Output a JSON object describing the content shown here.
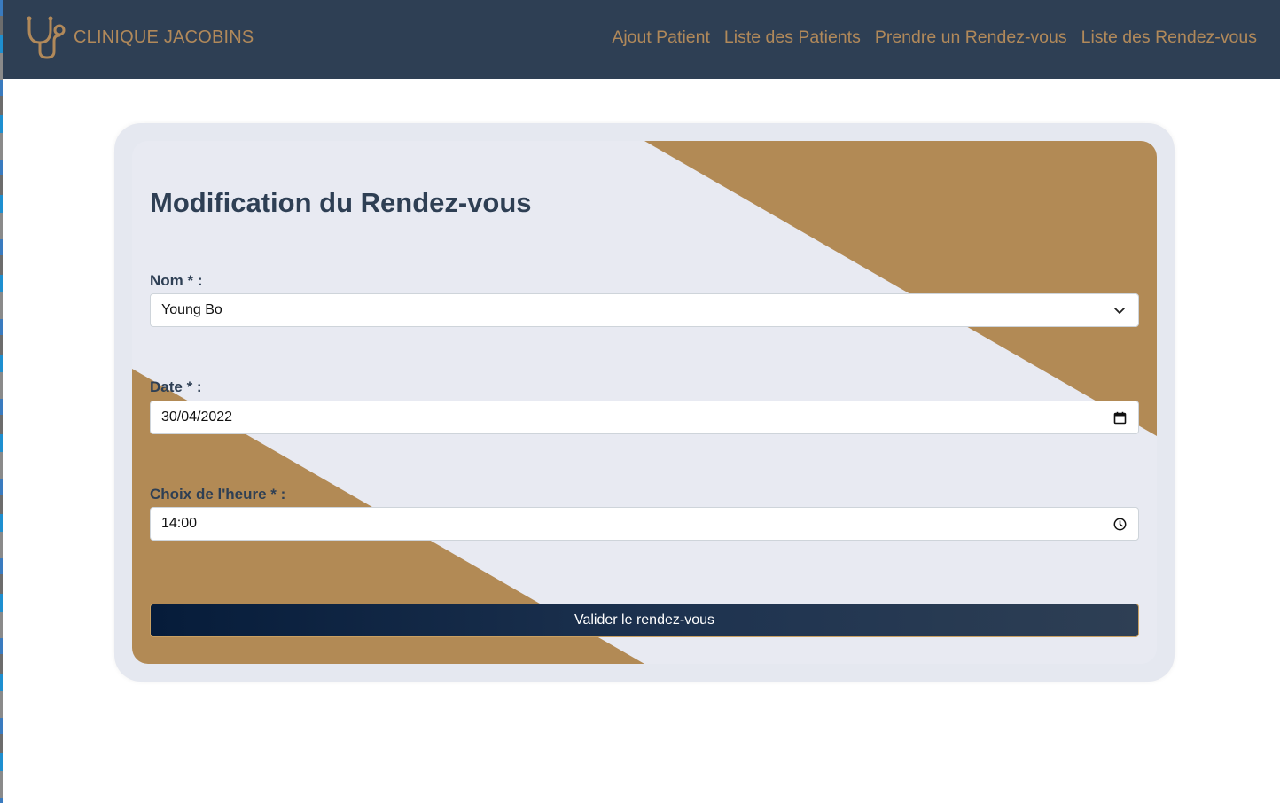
{
  "brand": {
    "name": "CLINIQUE JACOBINS",
    "logo_icon": "stethoscope-icon"
  },
  "nav": {
    "items": [
      {
        "label": "Ajout Patient"
      },
      {
        "label": "Liste des Patients"
      },
      {
        "label": "Prendre un Rendez-vous"
      },
      {
        "label": "Liste des Rendez-vous"
      }
    ]
  },
  "form": {
    "title": "Modification du Rendez-vous",
    "nom": {
      "label": "Nom * :",
      "value": "Young Bo",
      "icon": "chevron-down-icon"
    },
    "date": {
      "label": "Date * :",
      "value": "30/04/2022",
      "icon": "calendar-icon"
    },
    "heure": {
      "label": "Choix de l'heure * :",
      "value": "14:00",
      "icon": "clock-icon"
    },
    "submit_label": "Valider le rendez-vous"
  },
  "colors": {
    "navbar_bg": "#2e3f54",
    "accent_gold": "#b1895a",
    "card_bg": "#e8eaf2",
    "button_dark": "#061c3a"
  }
}
